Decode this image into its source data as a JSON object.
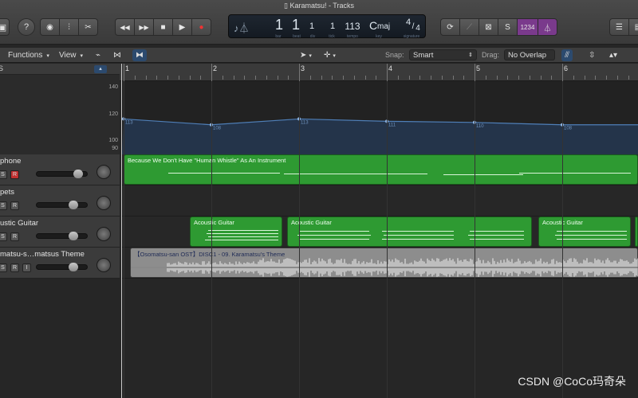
{
  "window": {
    "title": "Karamatsu! - Tracks"
  },
  "transport": {
    "rewind": "◀◀",
    "forward": "▶▶",
    "stop": "■",
    "play": "▶",
    "record": "●"
  },
  "lcd": {
    "bar": "1",
    "beat": "1",
    "div": "1",
    "tick": "1",
    "tempo": "113",
    "key": "C",
    "scale": "maj",
    "sig_top": "4",
    "sig_bottom": "4",
    "labels": {
      "bar": "bar",
      "beat": "beat",
      "div": "div",
      "tick": "tick",
      "tempo": "tempo",
      "key": "key",
      "sig": "signature"
    }
  },
  "right_toolbar": {
    "count_in": "1234"
  },
  "toolbar2": {
    "functions": "Functions",
    "view": "View",
    "snap_label": "Snap:",
    "snap_value": "Smart",
    "drag_label": "Drag:",
    "drag_value": "No Overlap"
  },
  "global_track_button": "S",
  "ruler": {
    "bars": [
      "1",
      "2",
      "3",
      "4",
      "5",
      "6"
    ]
  },
  "tempo_lane": {
    "scale_labels": [
      "140",
      "120",
      "100",
      "90"
    ],
    "points": [
      {
        "bar": 1,
        "tempo": "113"
      },
      {
        "bar": 2,
        "tempo": "108"
      },
      {
        "bar": 3,
        "tempo": "113"
      },
      {
        "bar": 4,
        "tempo": "111"
      },
      {
        "bar": 5,
        "tempo": "110"
      },
      {
        "bar": 6,
        "tempo": "108"
      }
    ]
  },
  "tracks": [
    {
      "name": "phone",
      "s": "S",
      "r": "R"
    },
    {
      "name": "pets",
      "s": "S",
      "r": "R"
    },
    {
      "name": "ustic Guitar",
      "s": "S",
      "r": "R"
    },
    {
      "name": "matsu-s…matsus Theme",
      "s": "S",
      "r": "R",
      "i": "I"
    }
  ],
  "regions": {
    "whistle": "Because We Don't Have \"Human Whistle\" As An Instrument",
    "guitar1": "Acoustic Guitar",
    "guitar2": "Acoustic Guitar",
    "guitar3": "Acoustic Guitar",
    "audio": "【Osomatsu-san OST】DISC1 - 09. Karamatsu's Theme"
  },
  "watermark": "CSDN @CoCo玛奇朵",
  "colors": {
    "region_green": "#2e9a32",
    "audio_gray": "#8d8d8d",
    "purple_button": "#7a3a8c"
  }
}
